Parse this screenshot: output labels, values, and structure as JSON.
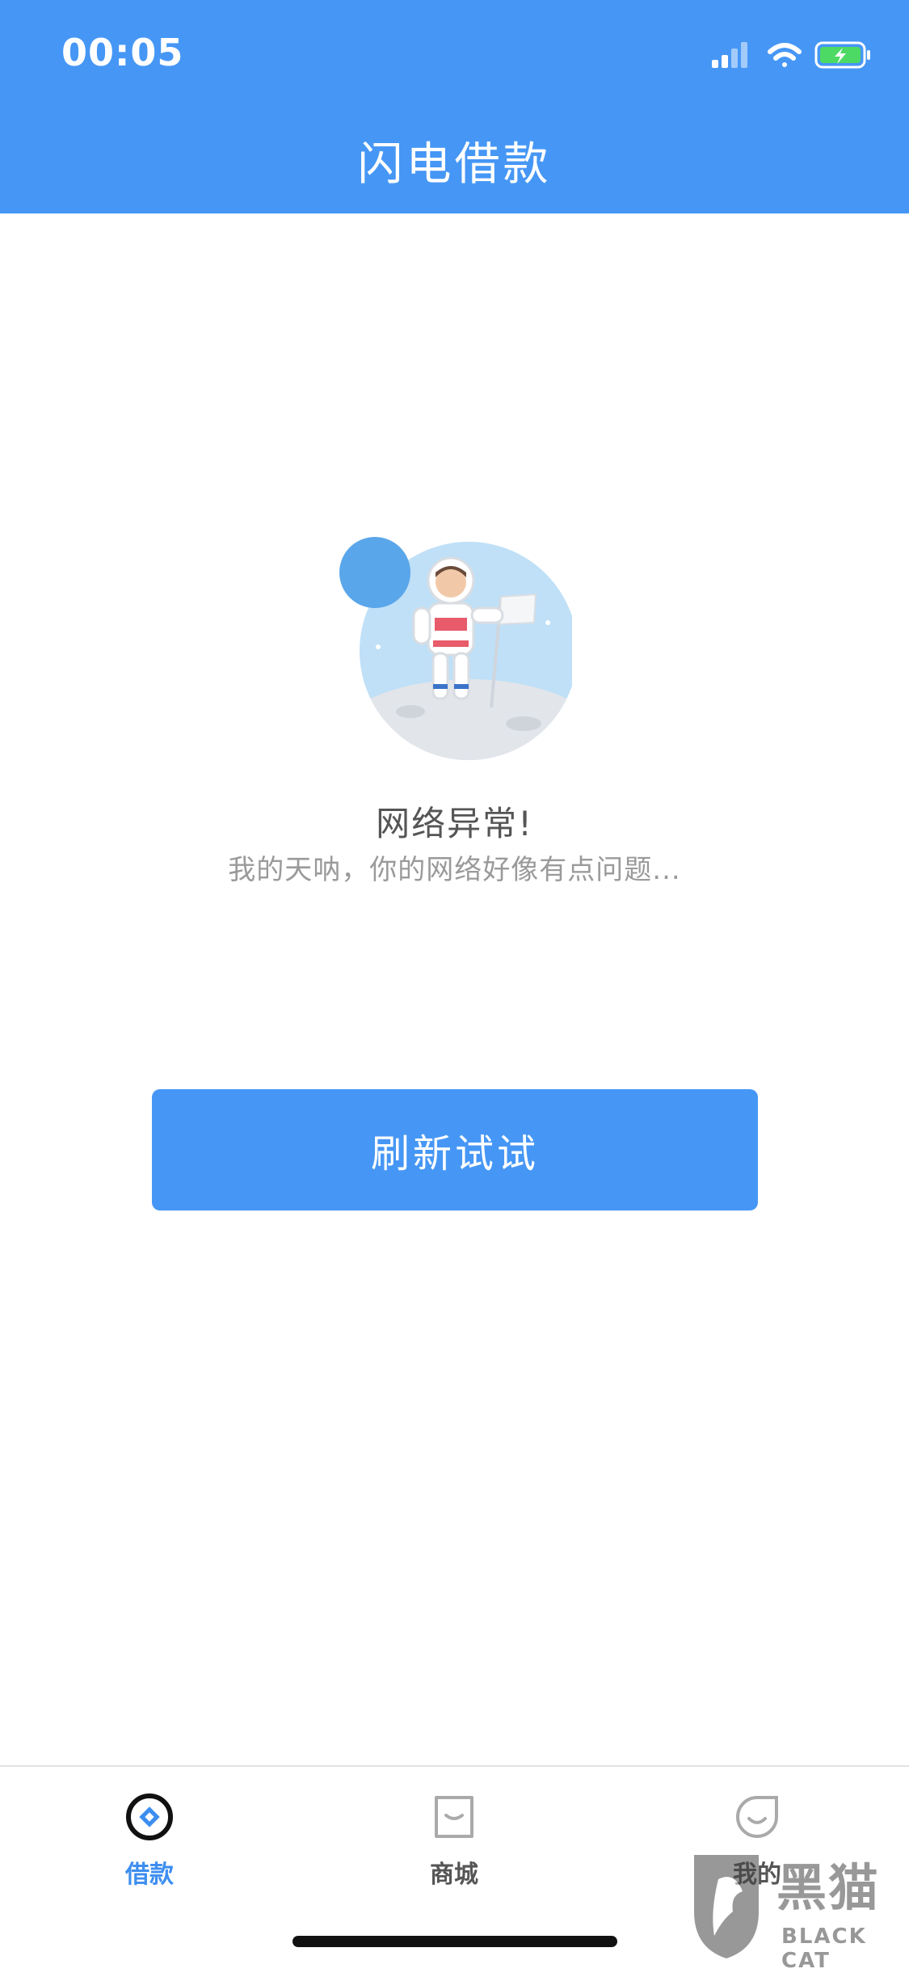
{
  "status_bar": {
    "time": "00:05",
    "icons": [
      "signal-icon",
      "wifi-icon",
      "battery-charging-icon"
    ]
  },
  "header": {
    "title": "闪电借款",
    "background": "#4697f5"
  },
  "error": {
    "title": "网络异常!",
    "subtitle": "我的天呐，你的网络好像有点问题..."
  },
  "refresh_button": {
    "label": "刷新试试",
    "color": "#4697f5"
  },
  "tabbar": {
    "tabs": [
      {
        "label": "借款",
        "icon": "loan-icon",
        "active": true,
        "color": "#3d8ef0"
      },
      {
        "label": "商城",
        "icon": "mall-icon",
        "active": false,
        "color": "#555555"
      },
      {
        "label": "我的",
        "icon": "profile-icon",
        "active": false,
        "color": "#555555"
      }
    ]
  },
  "watermark": {
    "text": "黑猫",
    "subtext": "BLACK CAT"
  }
}
